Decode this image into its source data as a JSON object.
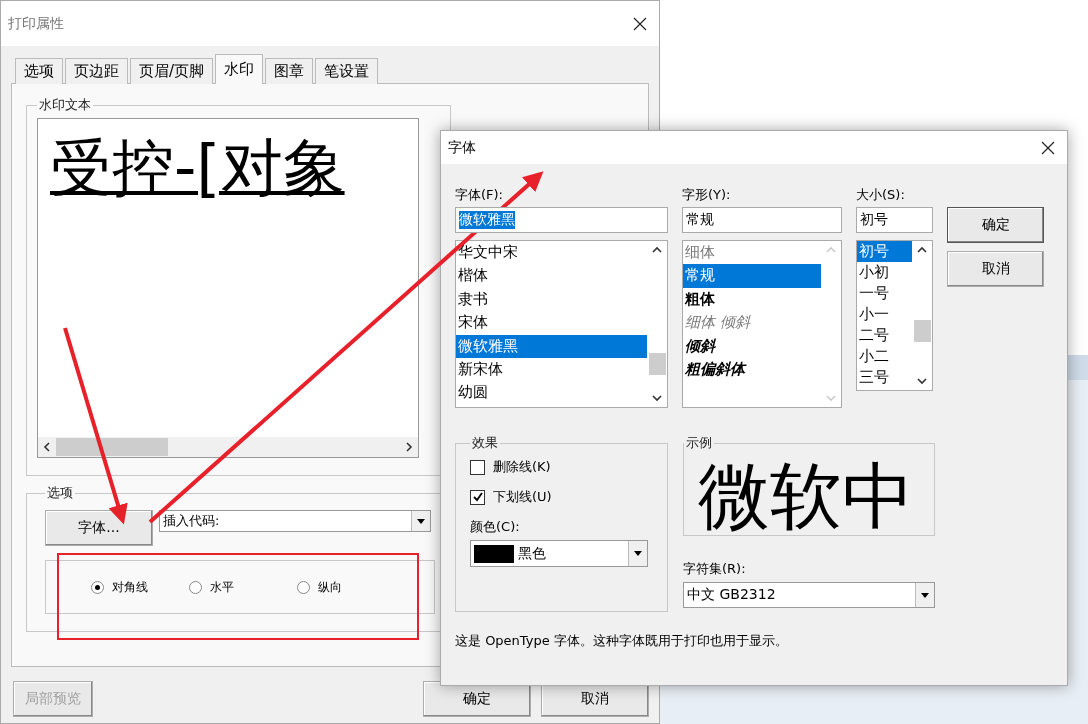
{
  "print_dialog": {
    "title": "打印属性",
    "tabs": [
      {
        "label": "选项",
        "selected": false
      },
      {
        "label": "页边距",
        "selected": false
      },
      {
        "label": "页眉/页脚",
        "selected": false
      },
      {
        "label": "水印",
        "selected": true
      },
      {
        "label": "图章",
        "selected": false
      },
      {
        "label": "笔设置",
        "selected": false
      }
    ],
    "watermark_group": {
      "label": "水印文本",
      "text": "受控-[对象"
    },
    "options_group": {
      "label": "选项",
      "font_button": "字体...",
      "insert_code": {
        "value": "插入代码:"
      },
      "orientation": [
        {
          "label": "对角线",
          "selected": true
        },
        {
          "label": "水平",
          "selected": false
        },
        {
          "label": "纵向",
          "selected": false
        }
      ]
    },
    "buttons": [
      {
        "label": "局部预览",
        "disabled": true
      },
      {
        "label": "确定",
        "disabled": false
      },
      {
        "label": "取消",
        "disabled": false
      }
    ]
  },
  "font_dialog": {
    "title": "字体",
    "font": {
      "label": "字体(F):",
      "value": "微软雅黑",
      "items": [
        {
          "label": "华文中宋",
          "selected": false
        },
        {
          "label": "楷体",
          "selected": false
        },
        {
          "label": "隶书",
          "selected": false
        },
        {
          "label": "宋体",
          "selected": false
        },
        {
          "label": "微软雅黑",
          "selected": true
        },
        {
          "label": "新宋体",
          "selected": false
        },
        {
          "label": "幼圆",
          "selected": false
        }
      ]
    },
    "style": {
      "label": "字形(Y):",
      "value": "常规",
      "items": [
        {
          "label": "细体",
          "selected": false,
          "kind": "light"
        },
        {
          "label": "常规",
          "selected": true,
          "kind": "regular"
        },
        {
          "label": "粗体",
          "selected": false,
          "kind": "bold"
        },
        {
          "label": "细体 倾斜",
          "selected": false,
          "kind": "light-italic"
        },
        {
          "label": "倾斜",
          "selected": false,
          "kind": "italic"
        },
        {
          "label": "粗偏斜体",
          "selected": false,
          "kind": "bold-italic"
        }
      ]
    },
    "size": {
      "label": "大小(S):",
      "value": "初号",
      "items": [
        {
          "label": "初号",
          "selected": true
        },
        {
          "label": "小初",
          "selected": false
        },
        {
          "label": "一号",
          "selected": false
        },
        {
          "label": "小一",
          "selected": false
        },
        {
          "label": "二号",
          "selected": false
        },
        {
          "label": "小二",
          "selected": false
        },
        {
          "label": "三号",
          "selected": false
        }
      ]
    },
    "buttons": [
      "确定",
      "取消"
    ],
    "effects": {
      "label": "效果",
      "options": [
        {
          "label": "删除线(K)",
          "checked": false
        },
        {
          "label": "下划线(U)",
          "checked": true
        }
      ],
      "color": {
        "label": "颜色(C):",
        "value": "黑色",
        "color": "#000000"
      }
    },
    "sample": {
      "label": "示例",
      "text": "微软中"
    },
    "charset": {
      "label": "字符集(R):",
      "value": "中文 GB2312"
    },
    "note": "这是 OpenType 字体。这种字体既用于打印也用于显示。"
  }
}
